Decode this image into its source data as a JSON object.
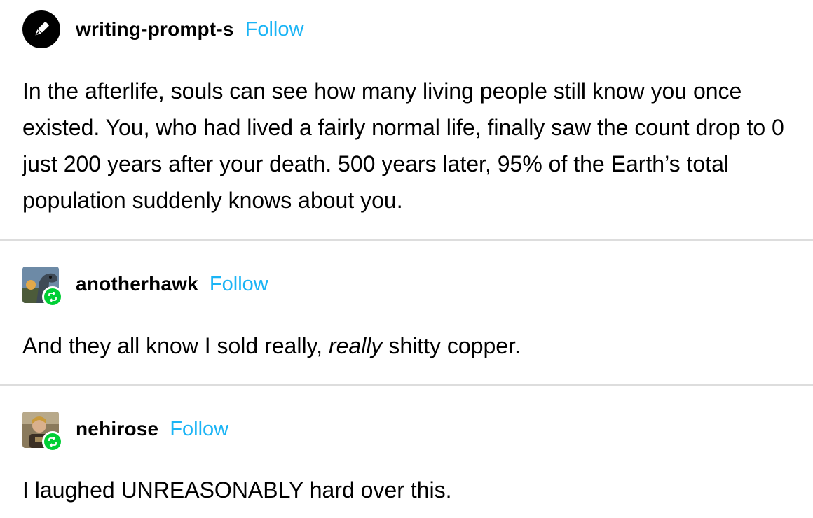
{
  "posts": [
    {
      "username": "writing-prompt-s",
      "follow_label": "Follow",
      "avatar_icon": "pen-nib-icon",
      "body": "In the afterlife, souls can see how many living people still know you once existed. You, who had lived a fairly normal life, finally saw the count drop to 0 just 200 years after your death. 500 years later, 95% of the Earth’s total population suddenly knows about you."
    },
    {
      "username": "anotherhawk",
      "follow_label": "Follow",
      "avatar_icon": "reblog-icon",
      "body_before": "And they all know I sold really, ",
      "body_em": "really",
      "body_after": " shitty copper."
    },
    {
      "username": "nehirose",
      "follow_label": "Follow",
      "avatar_icon": "reblog-icon",
      "body": "I laughed UNREASONABLY hard over this."
    }
  ],
  "colors": {
    "follow": "#1ab4f5",
    "reblog_badge": "#00cf35",
    "divider": "#dddddd",
    "text": "#000000"
  }
}
